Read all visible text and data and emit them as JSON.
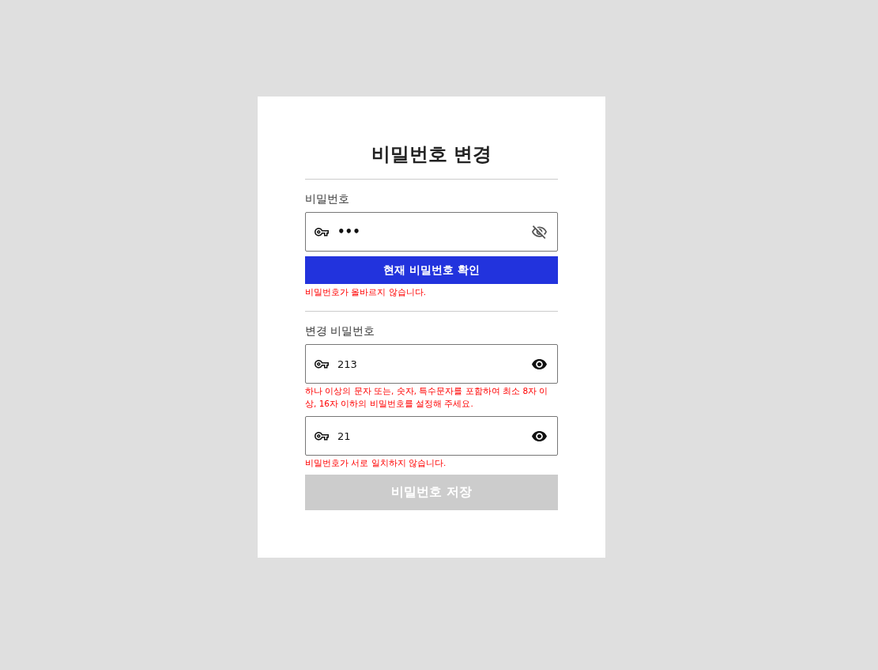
{
  "title": "비밀번호 변경",
  "current_password": {
    "label": "비밀번호",
    "field": {
      "value": "•••",
      "masked": true
    },
    "button": {
      "label": "현재 비밀번호 확인",
      "disabled": false
    },
    "error": "비밀번호가 올바르지 않습니다."
  },
  "new_password": {
    "label": "변경 비밀번호",
    "fields": [
      {
        "value": "213",
        "masked": false,
        "error": "하나 이상의 문자 또는, 숫자, 특수문자를 포함하여 최소 8자 이상, 16자 이하의 비밀번호를 설정해 주세요."
      },
      {
        "value": "21",
        "masked": false,
        "error": "비밀번호가 서로 일치하지 않습니다."
      }
    ]
  },
  "save_button": {
    "label": "비밀번호 저장",
    "disabled": true
  }
}
